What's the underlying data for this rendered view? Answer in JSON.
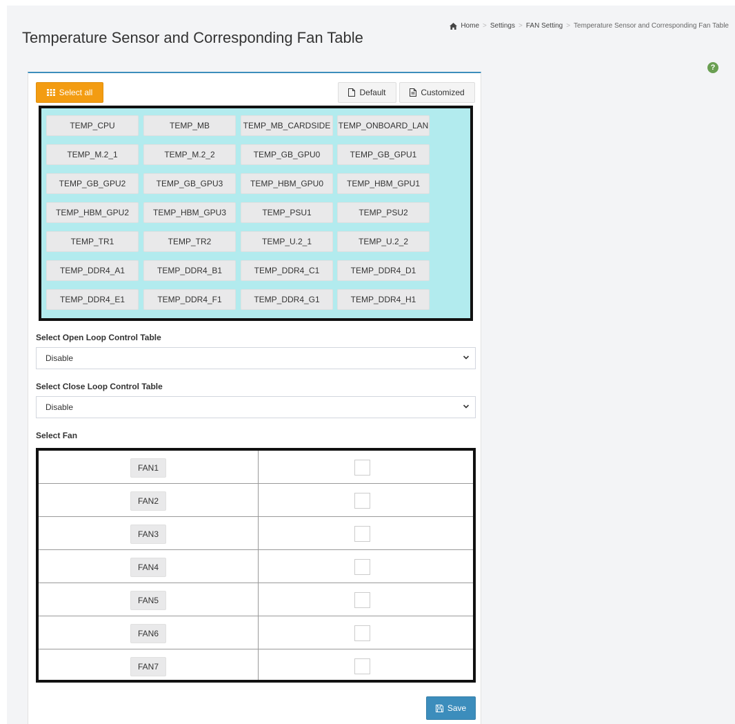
{
  "page": {
    "title": "Temperature Sensor and Corresponding Fan Table"
  },
  "breadcrumb": {
    "items": [
      "Home",
      "Settings",
      "FAN Setting",
      "Temperature Sensor and Corresponding Fan Table"
    ],
    "separator": ">"
  },
  "help": {
    "icon": "question-circle-icon",
    "glyph": "?"
  },
  "toolbar": {
    "select_all_label": "Select all",
    "default_label": "Default",
    "customized_label": "Customized"
  },
  "sensors": [
    "TEMP_CPU",
    "TEMP_MB",
    "TEMP_MB_CARDSIDE",
    "TEMP_ONBOARD_LAN",
    "TEMP_M.2_1",
    "TEMP_M.2_2",
    "TEMP_GB_GPU0",
    "TEMP_GB_GPU1",
    "TEMP_GB_GPU2",
    "TEMP_GB_GPU3",
    "TEMP_HBM_GPU0",
    "TEMP_HBM_GPU1",
    "TEMP_HBM_GPU2",
    "TEMP_HBM_GPU3",
    "TEMP_PSU1",
    "TEMP_PSU2",
    "TEMP_TR1",
    "TEMP_TR2",
    "TEMP_U.2_1",
    "TEMP_U.2_2",
    "TEMP_DDR4_A1",
    "TEMP_DDR4_B1",
    "TEMP_DDR4_C1",
    "TEMP_DDR4_D1",
    "TEMP_DDR4_E1",
    "TEMP_DDR4_F1",
    "TEMP_DDR4_G1",
    "TEMP_DDR4_H1"
  ],
  "open_loop": {
    "label": "Select Open Loop Control Table",
    "value": "Disable"
  },
  "close_loop": {
    "label": "Select Close Loop Control Table",
    "value": "Disable"
  },
  "fan_section": {
    "label": "Select Fan"
  },
  "fans": [
    {
      "name": "FAN1",
      "checked": false
    },
    {
      "name": "FAN2",
      "checked": false
    },
    {
      "name": "FAN3",
      "checked": false
    },
    {
      "name": "FAN4",
      "checked": false
    },
    {
      "name": "FAN5",
      "checked": false
    },
    {
      "name": "FAN6",
      "checked": false
    },
    {
      "name": "FAN7",
      "checked": false
    }
  ],
  "save_label": "Save",
  "colors": {
    "accent": "#3c8dbc",
    "select_all": "#f39c12",
    "sensor_bg": "#b2ebee",
    "help": "#6a9f52"
  }
}
